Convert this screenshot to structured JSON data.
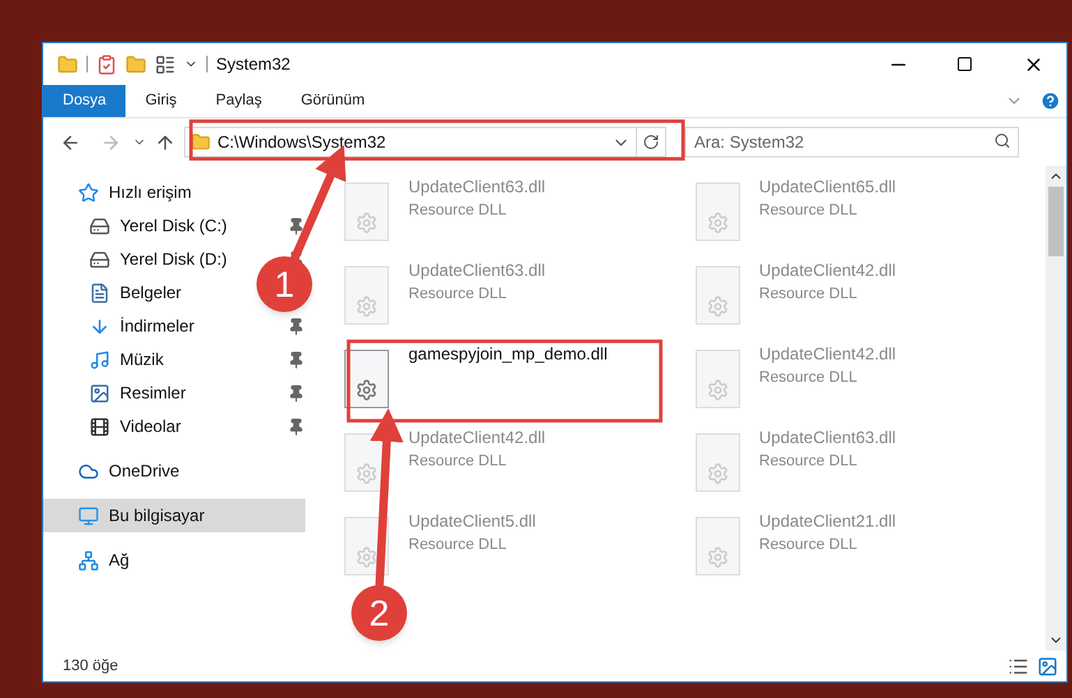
{
  "window": {
    "title": "System32"
  },
  "ribbon_tabs": [
    {
      "label": "Dosya",
      "selected": true
    },
    {
      "label": "Giriş",
      "selected": false
    },
    {
      "label": "Paylaş",
      "selected": false
    },
    {
      "label": "Görünüm",
      "selected": false
    }
  ],
  "address": {
    "path": "C:\\Windows\\System32"
  },
  "search": {
    "placeholder": "Ara: System32"
  },
  "sidebar": {
    "items": [
      {
        "label": "Hızlı erişim",
        "kind": "star",
        "selected": false,
        "children": [
          {
            "label": "Yerel Disk (C:)",
            "kind": "drive",
            "pinned": true,
            "selected": false
          },
          {
            "label": "Yerel Disk (D:)",
            "kind": "drive",
            "pinned": true,
            "selected": false
          },
          {
            "label": "Belgeler",
            "kind": "document",
            "pinned": false,
            "selected": false
          },
          {
            "label": "İndirmeler",
            "kind": "download",
            "pinned": true,
            "selected": false
          },
          {
            "label": "Müzik",
            "kind": "music",
            "pinned": true,
            "selected": false
          },
          {
            "label": "Resimler",
            "kind": "picture",
            "pinned": true,
            "selected": false
          },
          {
            "label": "Videolar",
            "kind": "video",
            "pinned": true,
            "selected": false
          }
        ]
      },
      {
        "label": "OneDrive",
        "kind": "cloud",
        "selected": false
      },
      {
        "label": "Bu bilgisayar",
        "kind": "computer",
        "selected": true
      },
      {
        "label": "Ağ",
        "kind": "network",
        "selected": false
      }
    ]
  },
  "files": [
    {
      "name": "UpdateClient63.dll",
      "type": "Resource DLL",
      "dimmed": true
    },
    {
      "name": "UpdateClient65.dll",
      "type": "Resource DLL",
      "dimmed": true
    },
    {
      "name": "UpdateClient63.dll",
      "type": "Resource DLL",
      "dimmed": true
    },
    {
      "name": "UpdateClient42.dll",
      "type": "Resource DLL",
      "dimmed": true
    },
    {
      "name": "gamespyjoin_mp_demo.dll",
      "dimmed": false
    },
    {
      "name": "UpdateClient42.dll",
      "type": "Resource DLL",
      "dimmed": true
    },
    {
      "name": "UpdateClient42.dll",
      "type": "Resource DLL",
      "dimmed": true
    },
    {
      "name": "UpdateClient63.dll",
      "type": "Resource DLL",
      "dimmed": true
    },
    {
      "name": "UpdateClient5.dll",
      "type": "Resource DLL",
      "dimmed": true
    },
    {
      "name": "UpdateClient21.dll",
      "type": "Resource DLL",
      "dimmed": true
    }
  ],
  "status_bar": {
    "item_count": "130 öğe"
  },
  "annotations": [
    {
      "label": "1"
    },
    {
      "label": "2"
    }
  ]
}
